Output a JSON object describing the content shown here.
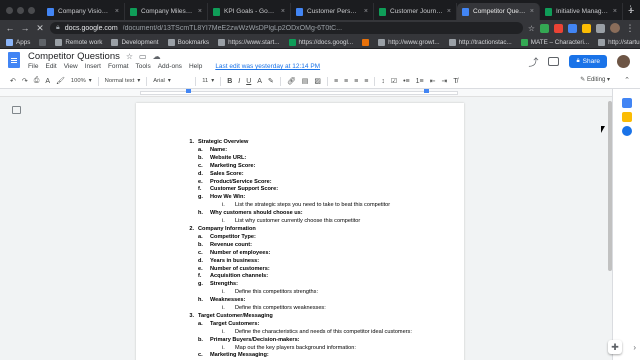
{
  "browser": {
    "tabs": [
      {
        "title": "Company Vision - G",
        "favicon": "docs-blue",
        "active": false
      },
      {
        "title": "Company Milestone",
        "favicon": "sheets-green",
        "active": false
      },
      {
        "title": "KPI Goals - Google",
        "favicon": "sheets-green",
        "active": false
      },
      {
        "title": "Customer Persona",
        "favicon": "docs-blue",
        "active": false
      },
      {
        "title": "Customer Journey",
        "favicon": "sheets-green",
        "active": false
      },
      {
        "title": "Competitor Questio",
        "favicon": "docs-blue",
        "active": true
      },
      {
        "title": "Initiative Managem",
        "favicon": "sheets-green",
        "active": false
      }
    ],
    "new_tab": "+",
    "url_host": "docs.google.com",
    "url_path": "/document/d/13TScmTL8YI7MeE2zwWzWsDPlgLp2ODxOMg-6T0tC...",
    "bookmarks": [
      {
        "label": "Apps",
        "icon": "apps-grid-icon",
        "color": "#8ab4f8"
      },
      {
        "label": "",
        "icon": "bookmark-icon",
        "color": "#5f6368"
      },
      {
        "label": "Remote work",
        "icon": "folder-icon",
        "color": "#9aa0a6"
      },
      {
        "label": "Development",
        "icon": "folder-icon",
        "color": "#9aa0a6"
      },
      {
        "label": "Bookmarks",
        "icon": "folder-icon",
        "color": "#9aa0a6"
      },
      {
        "label": "https://www.start...",
        "icon": "site-icon",
        "color": "#9aa0a6"
      },
      {
        "label": "https://docs.googl...",
        "icon": "sheets-icon",
        "color": "#0f9d58"
      },
      {
        "label": "",
        "icon": "site-icon",
        "color": "#e8710a"
      },
      {
        "label": "http://www.growt...",
        "icon": "site-icon",
        "color": "#9aa0a6"
      },
      {
        "label": "http://tractionstac...",
        "icon": "site-icon",
        "color": "#9aa0a6"
      },
      {
        "label": "MATE – Characteri...",
        "icon": "site-icon",
        "color": "#34a853"
      },
      {
        "label": "http://startupstas...",
        "icon": "site-icon",
        "color": "#9aa0a6"
      }
    ]
  },
  "docs": {
    "title": "Competitor Questions",
    "menu": [
      "File",
      "Edit",
      "View",
      "Insert",
      "Format",
      "Tools",
      "Add-ons",
      "Help"
    ],
    "last_edit": "Last edit was yesterday at 12:14 PM",
    "share_label": "Share",
    "toolbar": {
      "zoom": "100%",
      "style": "Normal text",
      "font": "Arial",
      "size": "11",
      "mode": "Editing"
    },
    "accent": "#1a73e8"
  },
  "document": {
    "lines": [
      {
        "level": 1,
        "num": "1.",
        "text": "Strategic Overview",
        "bold": true
      },
      {
        "level": 2,
        "num": "a.",
        "text": "Name:",
        "bold": true
      },
      {
        "level": 2,
        "num": "b.",
        "text": "Website URL:",
        "bold": true
      },
      {
        "level": 2,
        "num": "c.",
        "text": "Marketing Score:",
        "bold": true
      },
      {
        "level": 2,
        "num": "d.",
        "text": "Sales Score:",
        "bold": true
      },
      {
        "level": 2,
        "num": "e.",
        "text": "Product/Service Score:",
        "bold": true
      },
      {
        "level": 2,
        "num": "f.",
        "text": "Customer Support Score:",
        "bold": true
      },
      {
        "level": 2,
        "num": "g.",
        "text": "How We Win:",
        "bold": true
      },
      {
        "level": 3,
        "num": "i.",
        "text": "List the strategic steps you need to take to beat this competitor",
        "bold": false
      },
      {
        "level": 2,
        "num": "h.",
        "text": "Why customers should choose us:",
        "bold": true
      },
      {
        "level": 3,
        "num": "i.",
        "text": "List why customer currently choose this competitor",
        "bold": false
      },
      {
        "level": 1,
        "num": "2.",
        "text": "Company Information",
        "bold": true
      },
      {
        "level": 2,
        "num": "a.",
        "text": "Competitor Type:",
        "bold": true
      },
      {
        "level": 2,
        "num": "b.",
        "text": "Revenue count:",
        "bold": true
      },
      {
        "level": 2,
        "num": "c.",
        "text": "Number of employees:",
        "bold": true
      },
      {
        "level": 2,
        "num": "d.",
        "text": "Years in business:",
        "bold": true
      },
      {
        "level": 2,
        "num": "e.",
        "text": "Number of customers:",
        "bold": true
      },
      {
        "level": 2,
        "num": "f.",
        "text": "Acquisition channels:",
        "bold": true
      },
      {
        "level": 2,
        "num": "g.",
        "text": "Strengths:",
        "bold": true
      },
      {
        "level": 3,
        "num": "i.",
        "text": "Define this competitors strengths:",
        "bold": false
      },
      {
        "level": 2,
        "num": "h.",
        "text": "Weaknesses:",
        "bold": true
      },
      {
        "level": 3,
        "num": "i.",
        "text": "Define this competitors weaknesses:",
        "bold": false
      },
      {
        "level": 1,
        "num": "3.",
        "text": "Target Customer/Messaging",
        "bold": true
      },
      {
        "level": 2,
        "num": "a.",
        "text": "Target Customers:",
        "bold": true
      },
      {
        "level": 3,
        "num": "i.",
        "text": "Define the characteristics and needs of this competitor ideal customers:",
        "bold": false
      },
      {
        "level": 2,
        "num": "b.",
        "text": "Primary Buyers/Decision-makers:",
        "bold": true
      },
      {
        "level": 3,
        "num": "i.",
        "text": "Map out the key players background information:",
        "bold": false
      },
      {
        "level": 2,
        "num": "c.",
        "text": "Marketing Messaging:",
        "bold": true
      }
    ]
  }
}
